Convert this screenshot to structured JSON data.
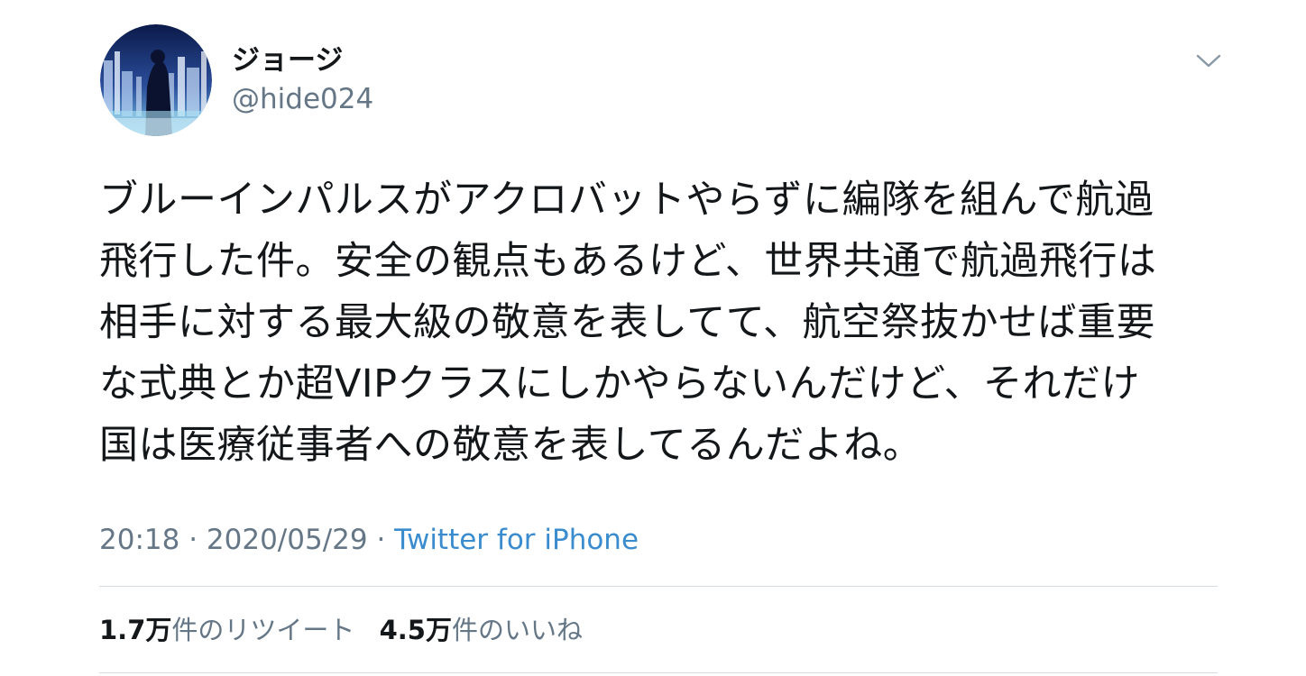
{
  "user": {
    "display_name": "ジョージ",
    "handle": "@hide024",
    "avatar_icon": "avatar-illustration-city-icon"
  },
  "menu": {
    "caret_icon": "chevron-down-icon"
  },
  "tweet": {
    "lines": [
      "ブルーインパルスがアクロバットやらずに編隊を組んで航過",
      "飛行した件。安全の観点もあるけど、世界共通で航過飛行は",
      "相手に対する最大級の敬意を表してて、航空祭抜かせば重要",
      "な式典とか超VIPクラスにしかやらないんだけど、それだけ",
      "国は医療従事者への敬意を表してるんだよね。"
    ]
  },
  "meta": {
    "time": "20:18",
    "sep1": " · ",
    "date": "2020/05/29",
    "sep2": " · ",
    "source": "Twitter for iPhone"
  },
  "stats": {
    "retweets_count": "1.7万",
    "retweets_label": "件のリツイート",
    "likes_count": "4.5万",
    "likes_label": "件のいいね"
  },
  "colors": {
    "text": "#14171a",
    "secondary": "#657786",
    "link": "#3a8ccf",
    "divider": "#d6dde2"
  }
}
